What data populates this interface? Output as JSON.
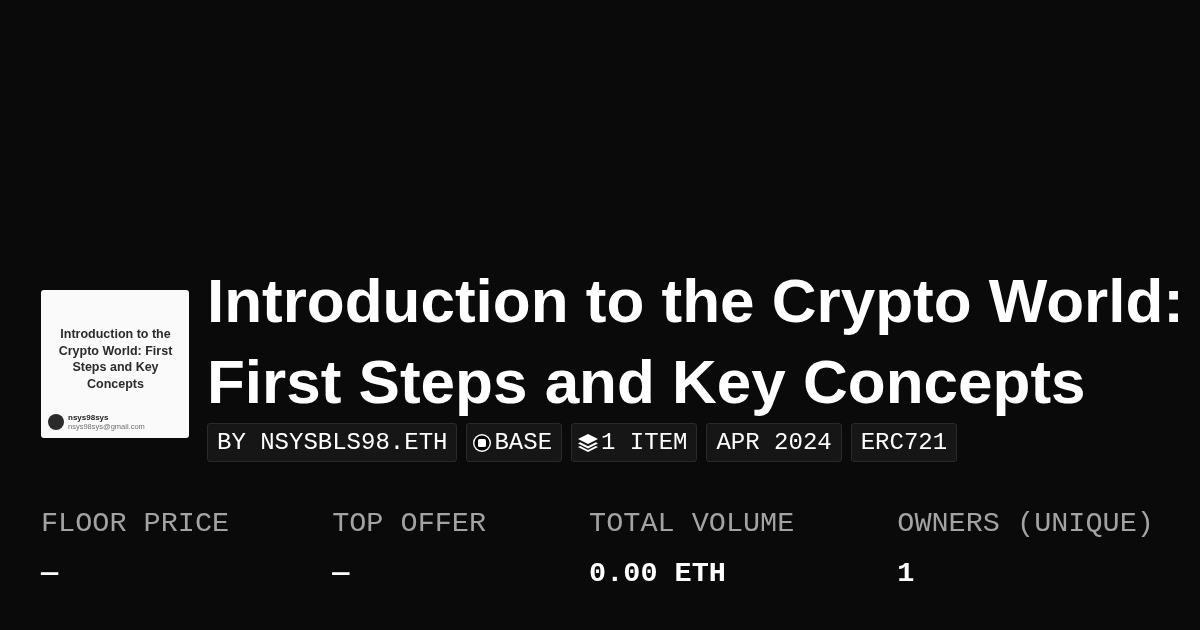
{
  "thumbnail": {
    "title": "Introduction to the Crypto World: First Steps and Key Concepts",
    "author": "nsys98sys",
    "email": "nsys98sys@gmail.com"
  },
  "title": "Introduction to the Crypto World: First Steps and Key Concepts",
  "tags": [
    {
      "kind": "creator",
      "label": "BY NSYSBLS98.ETH"
    },
    {
      "kind": "chain",
      "label": "BASE"
    },
    {
      "kind": "items",
      "label": "1 ITEM"
    },
    {
      "kind": "date",
      "label": "APR 2024"
    },
    {
      "kind": "standard",
      "label": "ERC721"
    }
  ],
  "stats": [
    {
      "label": "FLOOR PRICE",
      "value": "—"
    },
    {
      "label": "TOP OFFER",
      "value": "—"
    },
    {
      "label": "TOTAL VOLUME",
      "value": "0.00 ETH"
    },
    {
      "label": "OWNERS (UNIQUE)",
      "value": "1"
    }
  ]
}
